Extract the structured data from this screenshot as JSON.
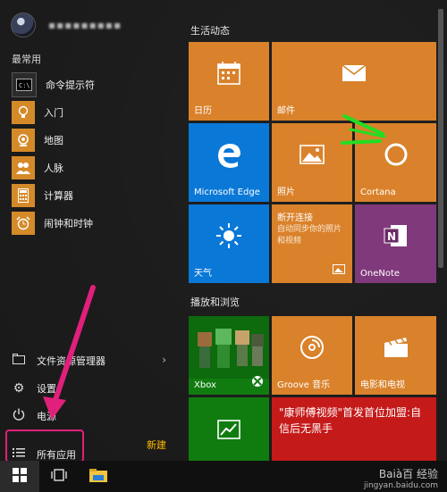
{
  "user": {
    "name": "▪▪▪▪▪▪▪▪▪"
  },
  "most_used": {
    "label": "最常用",
    "items": [
      {
        "label": "命令提示符",
        "icon": "command-prompt-icon",
        "color": "#2d2d2d"
      },
      {
        "label": "入门",
        "icon": "lightbulb-icon",
        "color": "#d58a2a"
      },
      {
        "label": "地图",
        "icon": "camera-icon",
        "color": "#d58a2a"
      },
      {
        "label": "人脉",
        "icon": "people-icon",
        "color": "#d58a2a"
      },
      {
        "label": "计算器",
        "icon": "calculator-icon",
        "color": "#d58a2a"
      },
      {
        "label": "闹钟和时钟",
        "icon": "alarm-clock-icon",
        "color": "#d58a2a"
      }
    ]
  },
  "bottom": {
    "file_explorer": "文件资源管理器",
    "settings": "设置",
    "power": "电源",
    "all_apps": "所有应用",
    "new_badge": "新建"
  },
  "groups": {
    "life": "生活动态",
    "play": "播放和浏览"
  },
  "tiles": {
    "calendar": {
      "label": "日历",
      "color": "#d9822b"
    },
    "mail": {
      "label": "邮件",
      "color": "#d9822b"
    },
    "edge": {
      "label": "Microsoft Edge",
      "color": "#0a78d7"
    },
    "photos": {
      "label": "照片",
      "color": "#d9822b"
    },
    "cortana": {
      "label": "Cortana",
      "color": "#d9822b"
    },
    "weather": {
      "label": "天气",
      "color": "#0a78d7"
    },
    "disconnected": {
      "title": "断开连接",
      "body": "自动同步你的照片和视频",
      "color": "#d9822b"
    },
    "onenote": {
      "label": "OneNote",
      "color": "#80397b"
    },
    "xbox": {
      "label": "Xbox",
      "color": "#107c10"
    },
    "groove": {
      "label": "Groove 音乐",
      "color": "#d9822b"
    },
    "movies": {
      "label": "电影和电视",
      "color": "#d9822b"
    },
    "money": {
      "color": "#107c10"
    },
    "news": {
      "headline": "\"康师傅视频\"首发首位加盟:自信后无黑手",
      "color": "#c51a1a"
    }
  },
  "watermark": {
    "brand": "Baià百 经验",
    "site": "jingyan.baidu.com"
  }
}
